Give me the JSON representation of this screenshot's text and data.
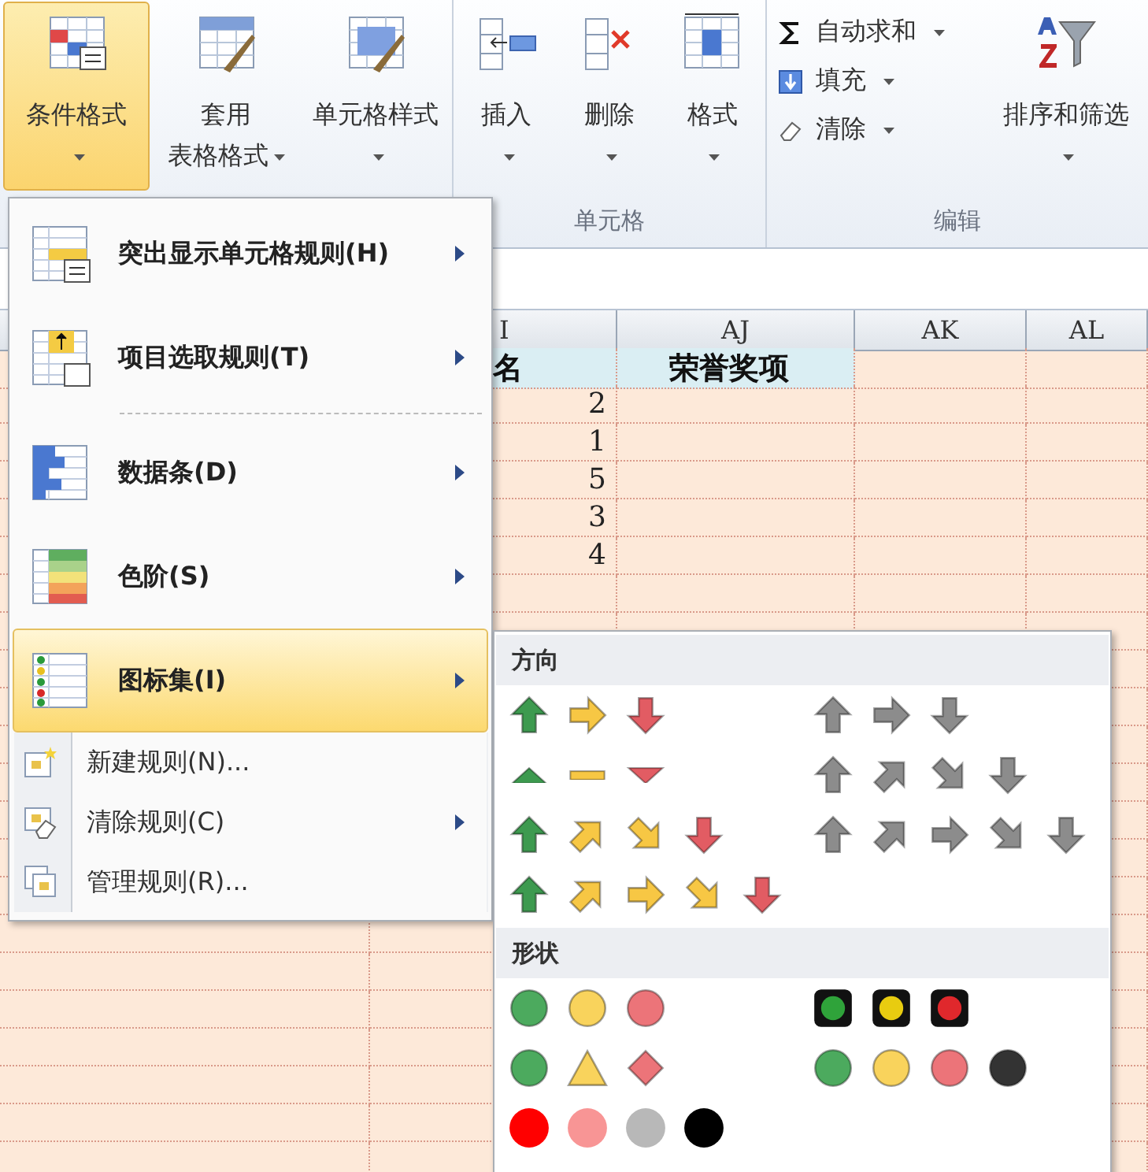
{
  "ribbon": {
    "groups": [
      {
        "buttons": [
          {
            "kind": "large",
            "lines": [
              "条件格式"
            ],
            "selected": true
          },
          {
            "kind": "large",
            "lines": [
              "套用",
              "表格格式"
            ],
            "selected": false
          },
          {
            "kind": "large",
            "lines": [
              "单元格样式"
            ],
            "selected": false
          }
        ]
      },
      {
        "label": "单元格",
        "buttons": [
          {
            "kind": "large",
            "lines": [
              "插入"
            ],
            "selected": false
          },
          {
            "kind": "large",
            "lines": [
              "删除"
            ],
            "selected": false
          },
          {
            "kind": "large",
            "lines": [
              "格式"
            ],
            "selected": false
          }
        ]
      },
      {
        "label": "编辑",
        "buttons": [
          {
            "kind": "small",
            "lines": [
              "自动求和"
            ]
          },
          {
            "kind": "small",
            "lines": [
              "填充"
            ]
          },
          {
            "kind": "small",
            "lines": [
              "清除"
            ]
          },
          {
            "kind": "large",
            "lines": [
              "排序和筛选"
            ],
            "selected": false
          }
        ]
      }
    ]
  },
  "sheet": {
    "columns": [
      {
        "label": "I"
      },
      {
        "label": "AJ"
      },
      {
        "label": "AK"
      },
      {
        "label": "AL"
      }
    ],
    "header_row": [
      "名",
      "荣誉奖项"
    ],
    "values": [
      "2",
      "1",
      "5",
      "3",
      "4"
    ]
  },
  "menu": {
    "items": [
      {
        "kind": "large",
        "label": "突出显示单元格规则(H)",
        "submenu": true,
        "selected": false
      },
      {
        "kind": "large",
        "label": "项目选取规则(T)",
        "submenu": true,
        "selected": false
      },
      {
        "kind": "separator"
      },
      {
        "kind": "large",
        "label": "数据条(D)",
        "submenu": true,
        "selected": false
      },
      {
        "kind": "large",
        "label": "色阶(S)",
        "submenu": true,
        "selected": false
      },
      {
        "kind": "large",
        "label": "图标集(I)",
        "submenu": true,
        "selected": true
      },
      {
        "kind": "small",
        "label": "新建规则(N)...",
        "submenu": false,
        "selected": false
      },
      {
        "kind": "small",
        "label": "清除规则(C)",
        "submenu": true,
        "selected": false
      },
      {
        "kind": "small",
        "label": "管理规则(R)...",
        "submenu": false,
        "selected": false
      }
    ]
  },
  "icon_sets": {
    "sections": [
      {
        "title": "方向",
        "sets": [
          {
            "icons": [
              {
                "kind": "up",
                "color": "#3d9a4f"
              },
              {
                "kind": "right",
                "color": "#f7c744"
              },
              {
                "kind": "down",
                "color": "#e25c63"
              }
            ]
          },
          {
            "icons": [
              {
                "kind": "up",
                "color": "#8c8c8c"
              },
              {
                "kind": "right",
                "color": "#8c8c8c"
              },
              {
                "kind": "down",
                "color": "#8c8c8c"
              }
            ]
          },
          {
            "icons": [
              {
                "kind": "triup",
                "color": "#3d9a4f"
              },
              {
                "kind": "bar",
                "color": "#f7c744"
              },
              {
                "kind": "tridown",
                "color": "#e25c63"
              }
            ]
          },
          {
            "icons": [
              {
                "kind": "up",
                "color": "#8c8c8c"
              },
              {
                "kind": "upright",
                "color": "#8c8c8c"
              },
              {
                "kind": "downright",
                "color": "#8c8c8c"
              },
              {
                "kind": "down",
                "color": "#8c8c8c"
              }
            ]
          },
          {
            "icons": [
              {
                "kind": "up",
                "color": "#3d9a4f"
              },
              {
                "kind": "upright",
                "color": "#f7c744"
              },
              {
                "kind": "downright",
                "color": "#f7c744"
              },
              {
                "kind": "down",
                "color": "#e25c63"
              }
            ]
          },
          {
            "icons": [
              {
                "kind": "up",
                "color": "#8c8c8c"
              },
              {
                "kind": "upright",
                "color": "#8c8c8c"
              },
              {
                "kind": "right",
                "color": "#8c8c8c"
              },
              {
                "kind": "downright",
                "color": "#8c8c8c"
              },
              {
                "kind": "down",
                "color": "#8c8c8c"
              }
            ]
          },
          {
            "icons": [
              {
                "kind": "up",
                "color": "#3d9a4f"
              },
              {
                "kind": "upright",
                "color": "#f7c744"
              },
              {
                "kind": "right",
                "color": "#f7c744"
              },
              {
                "kind": "downright",
                "color": "#f7c744"
              },
              {
                "kind": "down",
                "color": "#e25c63"
              }
            ]
          }
        ]
      },
      {
        "title": "形状",
        "sets": [
          {
            "icons": [
              {
                "kind": "circle",
                "color": "#4caa5e"
              },
              {
                "kind": "circle",
                "color": "#f9d35c"
              },
              {
                "kind": "circle",
                "color": "#ec7479"
              }
            ]
          },
          {
            "icons": [
              {
                "kind": "light",
                "color": "#2fa33a"
              },
              {
                "kind": "light",
                "color": "#e8cc10"
              },
              {
                "kind": "light",
                "color": "#e0282c"
              }
            ]
          },
          {
            "icons": [
              {
                "kind": "circle",
                "color": "#4caa5e"
              },
              {
                "kind": "triangle",
                "color": "#f9d35c"
              },
              {
                "kind": "diamond",
                "color": "#ec7479"
              }
            ]
          },
          {
            "icons": [
              {
                "kind": "circle",
                "color": "#4caa5e"
              },
              {
                "kind": "circle",
                "color": "#f9d35c"
              },
              {
                "kind": "circle",
                "color": "#ec7479"
              },
              {
                "kind": "circle",
                "color": "#333333"
              }
            ]
          },
          {
            "icons": [
              {
                "kind": "dot",
                "color": "#ff0000"
              },
              {
                "kind": "dot",
                "color": "#f89595"
              },
              {
                "kind": "dot",
                "color": "#b8b8b8"
              },
              {
                "kind": "dot",
                "color": "#000000"
              }
            ]
          }
        ]
      }
    ]
  }
}
